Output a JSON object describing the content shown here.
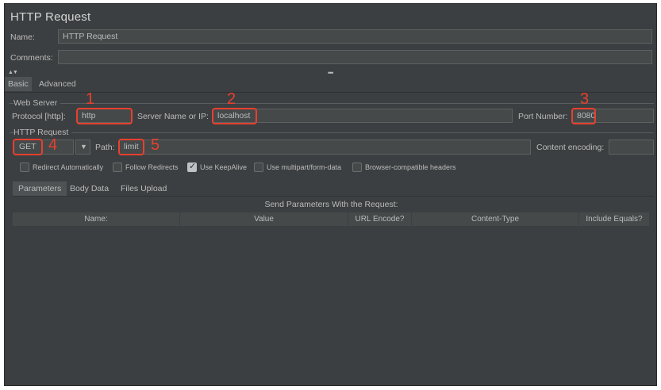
{
  "panel": {
    "title": "HTTP Request",
    "name_label": "Name:",
    "name_value": "HTTP Request",
    "comments_label": "Comments:",
    "comments_value": ""
  },
  "tabs": [
    "Basic",
    "Advanced"
  ],
  "web_server": {
    "group_title": "Web Server",
    "protocol_label": "Protocol [http]:",
    "protocol_value": "http",
    "server_label": "Server Name or IP:",
    "server_value": "localhost",
    "port_label": "Port Number:",
    "port_value": "8080"
  },
  "http_request": {
    "group_title": "HTTP Request",
    "method_value": "GET",
    "path_label": "Path:",
    "path_value": "limit",
    "encoding_label": "Content encoding:",
    "encoding_value": ""
  },
  "options": [
    {
      "label": "Redirect Automatically",
      "checked": false
    },
    {
      "label": "Follow Redirects",
      "checked": false
    },
    {
      "label": "Use KeepAlive",
      "checked": true
    },
    {
      "label": "Use multipart/form-data",
      "checked": false
    },
    {
      "label": "Browser-compatible headers",
      "checked": false
    }
  ],
  "subtabs": [
    "Parameters",
    "Body Data",
    "Files Upload"
  ],
  "params_caption": "Send Parameters With the Request:",
  "columns": [
    "Name:",
    "Value",
    "URL Encode?",
    "Content-Type",
    "Include Equals?"
  ],
  "annotations": [
    "1",
    "2",
    "3",
    "4",
    "5"
  ],
  "colors": {
    "background": "#3c3f41",
    "field": "#45494a",
    "text": "#bbbbbb",
    "annotation_red": "#e8402e"
  },
  "icons": {
    "splitter_arrows": "splitter-collapse-icon",
    "splitter_grip": "splitter-grip-icon",
    "dropdown": "chevron-down-icon",
    "checkmark": "check-icon"
  }
}
